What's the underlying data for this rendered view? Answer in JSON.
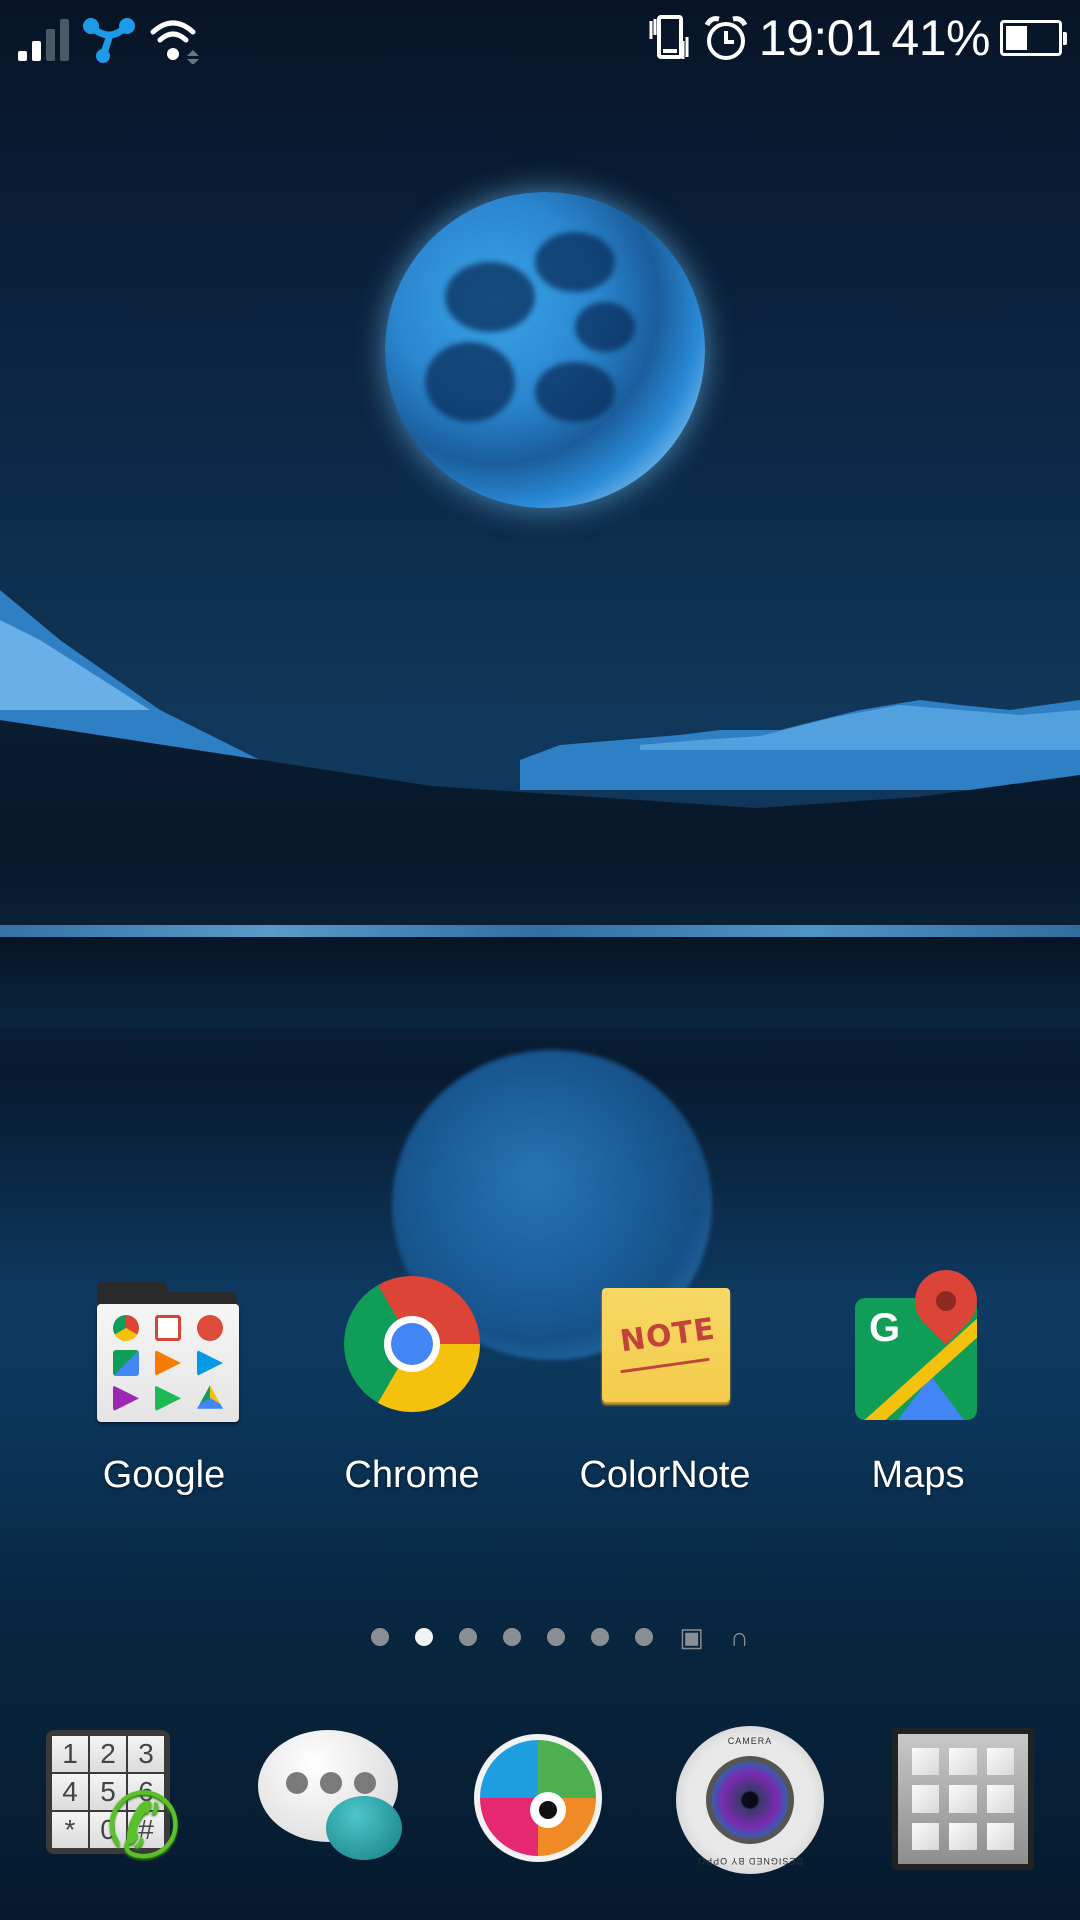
{
  "status_bar": {
    "signal_icon": "cellular-signal-icon",
    "signal_bars_active": 2,
    "signal_bars_total": 4,
    "network_app_icon": "share-network-icon",
    "wifi_icon": "wifi-icon",
    "vibrate_icon": "vibrate-icon",
    "alarm_icon": "alarm-clock-icon",
    "time": "19:01",
    "battery_percent_label": "41%",
    "battery_level": 0.41,
    "network_icon_color": "#1e9be8"
  },
  "wallpaper": {
    "description": "night lake with blue moon and reflection",
    "sky_color": "#0b2440",
    "moon_color": "#3aa3e8"
  },
  "home_apps": [
    {
      "label": "Google",
      "icon": "google-folder-icon"
    },
    {
      "label": "Chrome",
      "icon": "chrome-icon"
    },
    {
      "label": "ColorNote",
      "icon": "colornote-icon",
      "icon_text": "NOTE"
    },
    {
      "label": "Maps",
      "icon": "maps-icon",
      "icon_text": "G"
    }
  ],
  "google_folder_contents": [
    "chrome",
    "gmail",
    "google-plus",
    "maps",
    "play-music",
    "play-store-books",
    "play-newsstand",
    "play-games",
    "drive"
  ],
  "pager": {
    "page_count": 7,
    "active_index": 1,
    "extra_icons": [
      "gallery-icon",
      "headphones-icon"
    ]
  },
  "dock": [
    {
      "name": "phone-dialer",
      "icon": "dialer-icon",
      "keys": [
        "1",
        "2",
        "3",
        "4",
        "5",
        "6",
        "*",
        "0",
        "#"
      ]
    },
    {
      "name": "messages",
      "icon": "messages-icon"
    },
    {
      "name": "music",
      "icon": "music-disc-icon"
    },
    {
      "name": "camera",
      "icon": "camera-icon",
      "top_text": "CAMERA",
      "bottom_text": "DESIGNED BY OPPO"
    },
    {
      "name": "app-drawer",
      "icon": "app-drawer-icon"
    }
  ]
}
